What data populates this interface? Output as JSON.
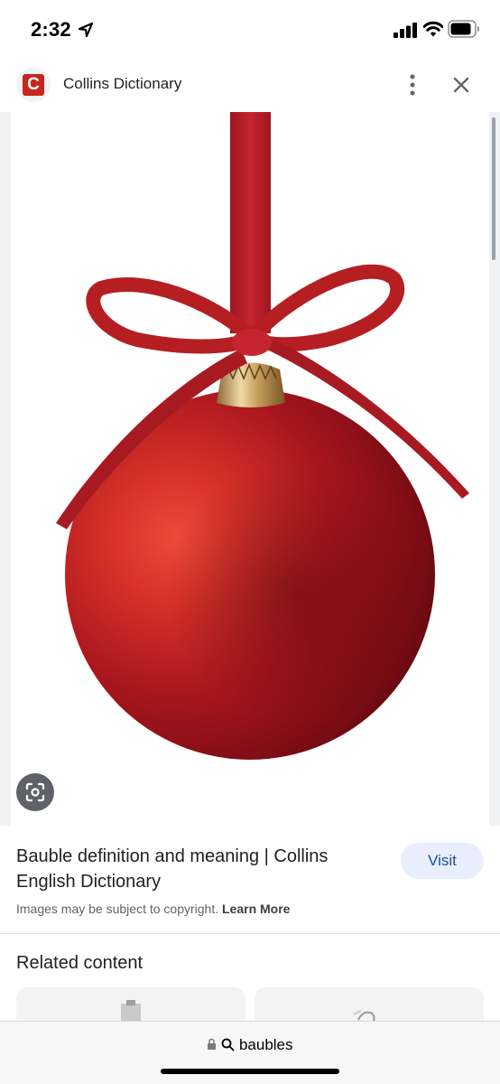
{
  "status_bar": {
    "time": "2:32",
    "icons": [
      "location-arrow-icon",
      "signal-icon",
      "wifi-icon",
      "battery-icon"
    ]
  },
  "header": {
    "site_logo_letter": "C",
    "site_name": "Collins Dictionary",
    "icons": [
      "more-vert-icon",
      "close-icon"
    ]
  },
  "image": {
    "subject": "red christmas bauble with ribbon bow",
    "accent_color": "#b51f22"
  },
  "result": {
    "title": "Bauble definition and meaning | Collins English Dictionary",
    "visit_label": "Visit",
    "copyright_text": "Images may be subject to copyright.",
    "learn_more": "Learn More"
  },
  "related": {
    "title": "Related content"
  },
  "bottom": {
    "query": "baubles",
    "icons": [
      "lock-icon",
      "search-icon"
    ]
  },
  "colors": {
    "logo_red": "#c8261f",
    "visit_bg": "#e8eefb",
    "visit_text": "#1a4f9c"
  }
}
